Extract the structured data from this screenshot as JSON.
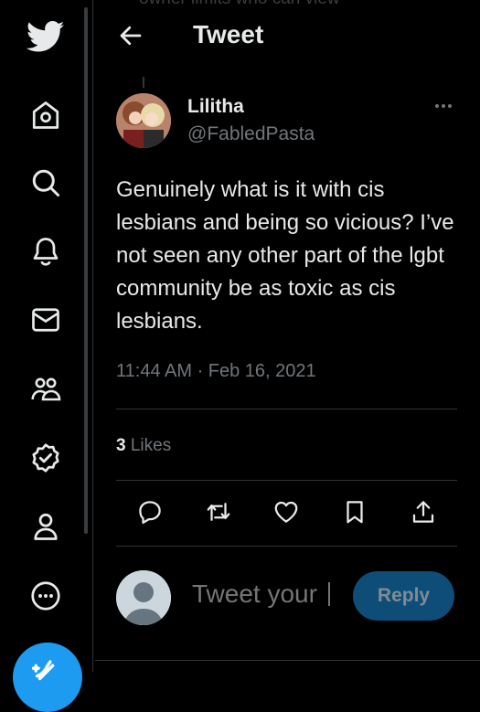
{
  "header": {
    "title": "Tweet",
    "faded_text": "owner limits who can view"
  },
  "tweet": {
    "author_name": "Lilitha",
    "author_handle": "@FabledPasta",
    "text": "Genuinely what is it with cis lesbians and being so vicious? I’ve not seen any other part of the lgbt community be as toxic as cis lesbians.",
    "timestamp": "11:44 AM · Feb 16, 2021",
    "likes_count": "3",
    "likes_label": "Likes"
  },
  "reply": {
    "placeholder": "Tweet your",
    "button_label": "Reply"
  },
  "nav": {
    "icons": [
      "twitter-logo-icon",
      "home-icon",
      "search-icon",
      "notifications-icon",
      "messages-icon",
      "communities-icon",
      "verified-icon",
      "profile-icon",
      "more-icon",
      "compose-icon"
    ]
  },
  "colors": {
    "accent": "#1d9bf0",
    "background": "#000000",
    "text": "#e7e9ea",
    "muted": "#71767b",
    "divider": "#2f3336"
  }
}
